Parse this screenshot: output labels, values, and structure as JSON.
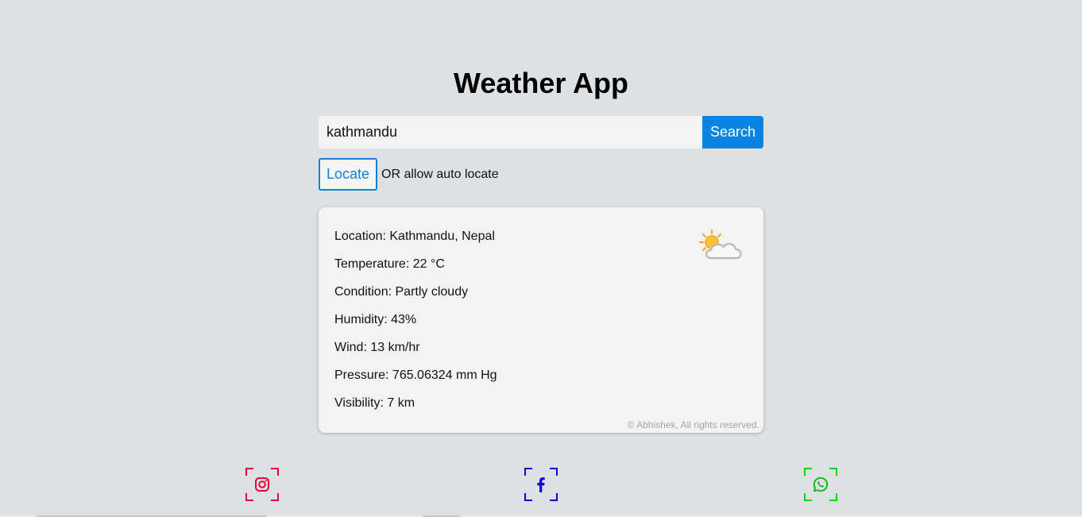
{
  "app": {
    "title": "Weather App"
  },
  "search": {
    "value": "kathmandu",
    "placeholder": "",
    "button_label": "Search"
  },
  "locate": {
    "button_label": "Locate",
    "hint": "OR allow auto locate"
  },
  "weather": {
    "location": "Location: Kathmandu, Nepal",
    "temperature": "Temperature: 22 °C",
    "condition": "Condition: Partly cloudy",
    "humidity": "Humidity: 43%",
    "wind": "Wind: 13 km/hr",
    "pressure": "Pressure: 765.06324 mm Hg",
    "visibility": "Visibility: 7 km",
    "icon": "partly-cloudy-icon"
  },
  "footer": {
    "copyright": "© Abhishek, All rights reserved."
  },
  "social": [
    {
      "name": "instagram-icon",
      "color": "#e4003a"
    },
    {
      "name": "facebook-icon",
      "color": "#0c00d6"
    },
    {
      "name": "whatsapp-icon",
      "color": "#00d60c"
    }
  ],
  "colors": {
    "background": "#dee1e4",
    "accent": "#0a84e3",
    "card": "#f3f3f3"
  }
}
